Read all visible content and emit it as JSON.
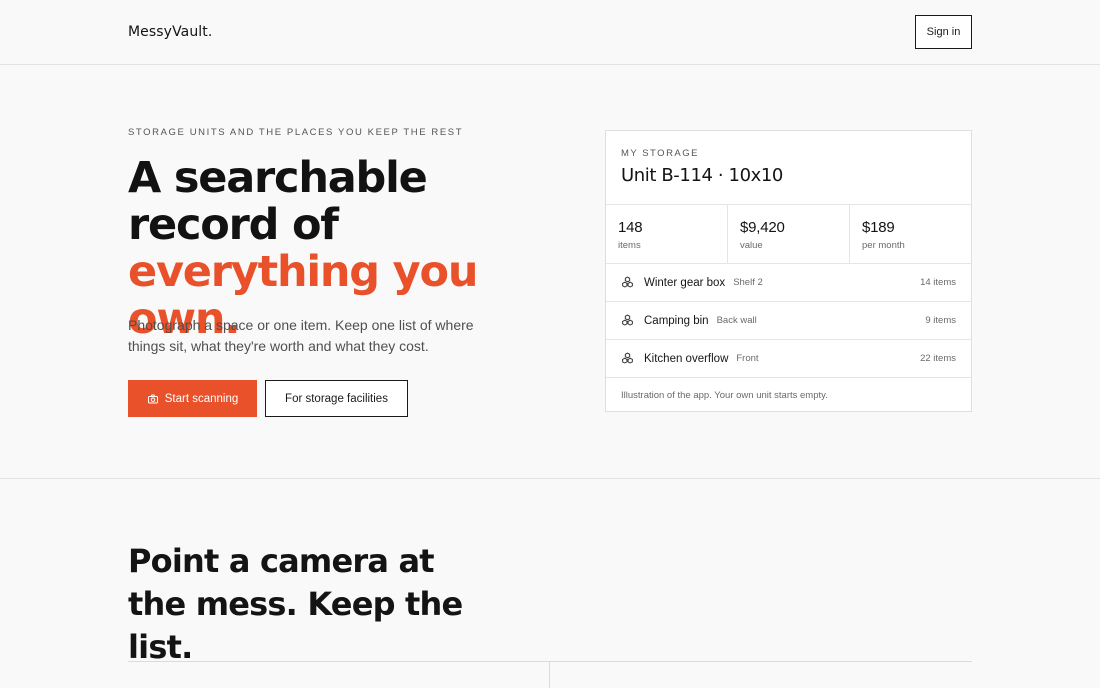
{
  "header": {
    "logo": "MessyVault.",
    "signin_label": "Sign in"
  },
  "hero": {
    "eyebrow": "STORAGE UNITS AND THE PLACES YOU KEEP THE REST",
    "headline_part1": "A searchable record of ",
    "headline_accent": "everything you own.",
    "subtitle": "Photograph a space or one item. Keep one list of where things sit, what they're worth and what they cost.",
    "primary_button": "Start scanning",
    "secondary_button": "For storage facilities"
  },
  "card": {
    "eyebrow": "MY STORAGE",
    "title": "Unit B-114 · 10x10",
    "stats": [
      {
        "value": "148",
        "label": "items"
      },
      {
        "value": "$9,420",
        "label": "value"
      },
      {
        "value": "$189",
        "label": "per month"
      }
    ],
    "rows": [
      {
        "name": "Winter gear box",
        "location": "Shelf 2",
        "count": "14 items",
        "icon": "boxes-icon"
      },
      {
        "name": "Camping bin",
        "location": "Back wall",
        "count": "9 items",
        "icon": "boxes-icon"
      },
      {
        "name": "Kitchen overflow",
        "location": "Front",
        "count": "22 items",
        "icon": "boxes-icon"
      }
    ],
    "note": "Illustration of the app. Your own unit starts empty."
  },
  "section": {
    "title": "Point a camera at the mess. Keep the list."
  },
  "colors": {
    "accent": "#e8512a",
    "text": "#141414",
    "background": "#faf9f9"
  }
}
